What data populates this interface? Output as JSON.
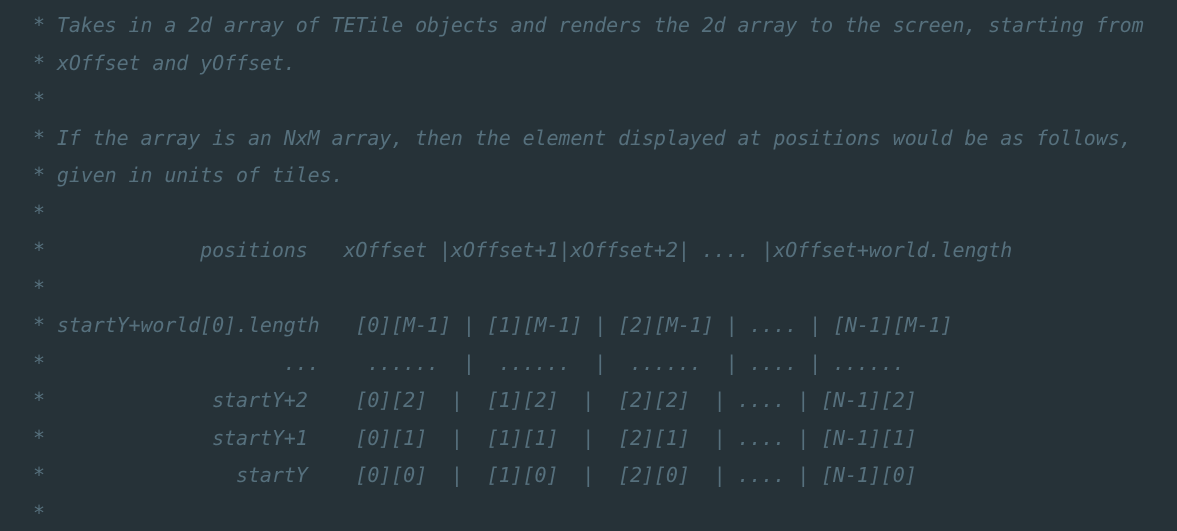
{
  "editor": {
    "comment_lines": [
      "* Takes in a 2d array of TETile objects and renders the 2d array to the screen, starting from",
      "* xOffset and yOffset.",
      "*",
      "* If the array is an NxM array, then the element displayed at positions would be as follows,",
      "* given in units of tiles.",
      "*",
      "*             positions   xOffset |xOffset+1|xOffset+2| .... |xOffset+world.length",
      "*",
      "* startY+world[0].length   [0][M-1] | [1][M-1] | [2][M-1] | .... | [N-1][M-1]",
      "*                    ...    ......  |  ......  |  ......  | .... | ......",
      "*              startY+2    [0][2]  |  [1][2]  |  [2][2]  | .... | [N-1][2]",
      "*              startY+1    [0][1]  |  [1][1]  |  [2][1]  | .... | [N-1][1]",
      "*                startY    [0][0]  |  [1][0]  |  [2][0]  | .... | [N-1][0]",
      "*"
    ]
  },
  "colors": {
    "background": "#263238",
    "comment_text": "#56707d"
  }
}
